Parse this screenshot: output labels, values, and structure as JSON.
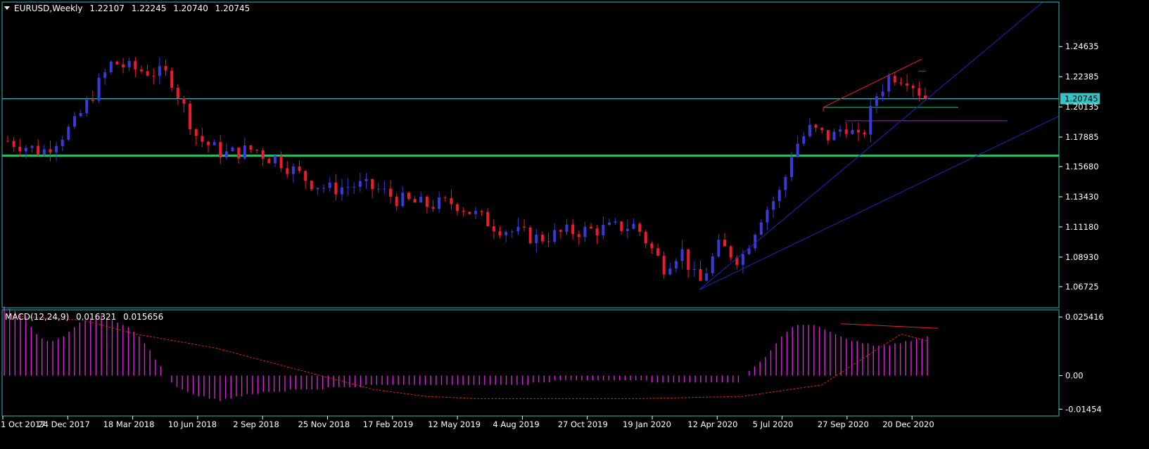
{
  "header": {
    "symbol": "EURUSD,Weekly",
    "open": "1.22107",
    "high": "1.22245",
    "low": "1.20740",
    "close": "1.20745",
    "macd_label": "MACD(12,24,9)",
    "macd_value": "0.016321",
    "signal_value": "0.015656"
  },
  "colors": {
    "background": "#000000",
    "frame": "#2fb9b9",
    "bull": "#3a3ad8",
    "bear": "#ee1a2e",
    "macd_hist": "#dd22dd",
    "signal": "#dd2222",
    "trendline": "#2424b8",
    "support_line": "#22bb66",
    "current_price_line": "#33c4c4",
    "resistance_line": "#ee2222",
    "purple_line": "#9a22c8"
  },
  "chart_data": [
    {
      "type": "candlestick",
      "name": "EURUSD,Weekly",
      "yaxis": {
        "ticks": [
          "1.24635",
          "1.22385",
          "1.20135",
          "1.17885",
          "1.15680",
          "1.13430",
          "1.11180",
          "1.08930",
          "1.06725"
        ],
        "range": [
          1.0515,
          1.2795
        ]
      },
      "xaxis": {
        "ticks": [
          "1 Oct 2017",
          "24 Dec 2017",
          "18 Mar 2018",
          "10 Jun 2018",
          "2 Sep 2018",
          "25 Nov 2018",
          "17 Feb 2019",
          "12 May 2019",
          "4 Aug 2019",
          "27 Oct 2019",
          "19 Jan 2020",
          "12 Apr 2020",
          "5 Jul 2020",
          "27 Sep 2020",
          "20 Dec 2020"
        ],
        "bars": 175
      },
      "current_price": "1.20745",
      "horizontal_levels": [
        1.165,
        1.201,
        1.191
      ],
      "trendlines": [
        {
          "from": [
            "2020-03-15",
            1.065
          ],
          "to": [
            "2021-08-01",
            1.28
          ]
        },
        {
          "from": [
            "2020-03-15",
            1.065
          ],
          "to": [
            "2021-03-07",
            1.196
          ]
        },
        {
          "from": [
            "2020-08-23",
            1.201
          ],
          "to": [
            "2020-12-20",
            1.237
          ]
        }
      ],
      "segments": [
        {
          "x": [
            0,
            50,
            95,
            150,
            175,
            232,
            272,
            310,
            355,
            373,
            378,
            393,
            415,
            435,
            462,
            500,
            530,
            560,
            600,
            640,
            700,
            760,
            800,
            850,
            900,
            940,
            965,
            990,
            1020,
            1050,
            1080,
            1110,
            1125,
            1150,
            1180,
            1200,
            1222,
            1245,
            1265,
            1290,
            1315
          ],
          "close": [
            1.176,
            1.168,
            1.188,
            1.235,
            1.23,
            1.225,
            1.178,
            1.166,
            1.17,
            1.163,
            1.165,
            1.16,
            1.152,
            1.145,
            1.14,
            1.143,
            1.14,
            1.132,
            1.128,
            1.13,
            1.112,
            1.103,
            1.108,
            1.11,
            1.113,
            1.082,
            1.095,
            1.068,
            1.098,
            1.087,
            1.12,
            1.14,
            1.17,
            1.185,
            1.178,
            1.188,
            1.175,
            1.21,
            1.225,
            1.223,
            1.2075
          ]
        }
      ]
    },
    {
      "type": "bar",
      "name": "MACD(12,24,9)",
      "yaxis": {
        "ticks": [
          "0.025416",
          "0.00",
          "-0.01454"
        ],
        "range": [
          -0.0175,
          0.0285
        ]
      },
      "histogram": [
        0.03,
        0.029,
        0.028,
        0.027,
        0.025,
        0.021,
        0.018,
        0.016,
        0.015,
        0.015,
        0.016,
        0.017,
        0.019,
        0.021,
        0.023,
        0.024,
        0.025,
        0.026,
        0.026,
        0.025,
        0.024,
        0.023,
        0.022,
        0.021,
        0.019,
        0.017,
        0.014,
        0.011,
        0.007,
        0.004,
        0.0,
        -0.003,
        -0.005,
        -0.006,
        -0.007,
        -0.008,
        -0.009,
        -0.009,
        -0.01,
        -0.01,
        -0.011,
        -0.01,
        -0.01,
        -0.009,
        -0.009,
        -0.008,
        -0.008,
        -0.008,
        -0.007,
        -0.007,
        -0.007,
        -0.007,
        -0.007,
        -0.006,
        -0.006,
        -0.006,
        -0.006,
        -0.006,
        -0.006,
        -0.006,
        -0.005,
        -0.005,
        -0.005,
        -0.005,
        -0.005,
        -0.005,
        -0.005,
        -0.004,
        -0.004,
        -0.004,
        -0.004,
        -0.004,
        -0.004,
        -0.004,
        -0.004,
        -0.004,
        -0.004,
        -0.004,
        -0.004,
        -0.004,
        -0.004,
        -0.004,
        -0.004,
        -0.004,
        -0.004,
        -0.004,
        -0.004,
        -0.004,
        -0.004,
        -0.004,
        -0.004,
        -0.004,
        -0.004,
        -0.004,
        -0.004,
        -0.004,
        -0.004,
        -0.004,
        -0.003,
        -0.003,
        -0.003,
        -0.003,
        -0.002,
        -0.002,
        -0.002,
        -0.002,
        -0.002,
        -0.002,
        -0.002,
        -0.002,
        -0.002,
        -0.002,
        -0.002,
        -0.002,
        -0.002,
        -0.002,
        -0.002,
        -0.002,
        -0.002,
        -0.002,
        -0.003,
        -0.003,
        -0.003,
        -0.003,
        -0.003,
        -0.003,
        -0.003,
        -0.003,
        -0.003,
        -0.003,
        -0.003,
        -0.003,
        -0.003,
        -0.003,
        -0.003,
        -0.003,
        -0.003,
        0.0,
        0.002,
        0.004,
        0.006,
        0.008,
        0.011,
        0.014,
        0.017,
        0.019,
        0.021,
        0.022,
        0.022,
        0.022,
        0.022,
        0.021,
        0.02,
        0.019,
        0.018,
        0.017,
        0.016,
        0.015,
        0.015,
        0.014,
        0.014,
        0.013,
        0.013,
        0.013,
        0.013,
        0.014,
        0.014,
        0.015,
        0.015,
        0.016,
        0.016,
        0.017
      ],
      "signal": {
        "x": [
          0,
          15,
          25,
          40,
          55,
          70,
          80,
          90,
          105,
          120,
          140,
          155,
          170,
          175
        ],
        "y": [
          0.026,
          0.024,
          0.018,
          0.012,
          0.003,
          -0.006,
          -0.009,
          -0.01,
          -0.01,
          -0.01,
          -0.009,
          -0.004,
          0.018,
          0.015
        ]
      },
      "divergence_line": {
        "from": [
          155,
          0.0225
        ],
        "to": [
          173,
          0.0205
        ]
      }
    }
  ]
}
